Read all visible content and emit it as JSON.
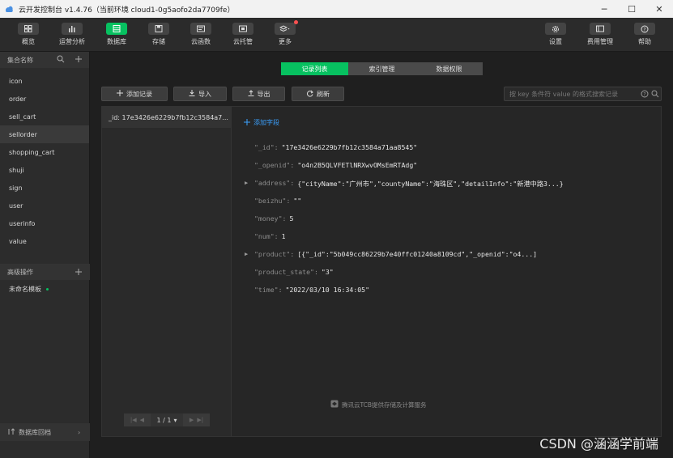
{
  "window": {
    "title": "云开发控制台 v1.4.76（当前环境 cloud1-0g5aofo2da7709fe）",
    "controls": [
      "minimize-icon",
      "maximize-icon",
      "close-icon"
    ]
  },
  "toolbar": {
    "items": [
      {
        "label": "概览",
        "icon": "overview-icon"
      },
      {
        "label": "运营分析",
        "icon": "analytics-icon"
      },
      {
        "label": "数据库",
        "icon": "database-icon",
        "active": true
      },
      {
        "label": "存储",
        "icon": "storage-icon"
      },
      {
        "label": "云函数",
        "icon": "function-icon"
      },
      {
        "label": "云托管",
        "icon": "cloud-hosting-icon"
      },
      {
        "label": "更多",
        "icon": "more-icon",
        "badge": true
      }
    ],
    "right_items": [
      {
        "label": "设置",
        "icon": "settings-icon"
      },
      {
        "label": "费用管理",
        "icon": "billing-icon"
      },
      {
        "label": "帮助",
        "icon": "help-icon"
      }
    ],
    "accent": "#07c160"
  },
  "sidebar": {
    "header": "集合名称",
    "collections": [
      "icon",
      "order",
      "sell_cart",
      "sellorder",
      "shopping_cart",
      "shuji",
      "sign",
      "user",
      "userinfo",
      "value"
    ],
    "selected": "sellorder",
    "advanced_header": "高级操作",
    "advanced_item": "未命名模板",
    "footer": "数据库回档"
  },
  "tabs": [
    "记录列表",
    "索引管理",
    "数据权限"
  ],
  "actions": {
    "add": "添加记录",
    "import": "导入",
    "export": "导出",
    "refresh": "刷新"
  },
  "search": {
    "placeholder": "按 key 条件符 value 的格式搜索记录"
  },
  "records": {
    "items": [
      "_id: 17e3426e6229b7fb12c3584a7..."
    ],
    "pager": "1 / 1"
  },
  "detail": {
    "add_field": "添加字段",
    "fields": [
      {
        "key": "\"_id\"",
        "value": "\"17e3426e6229b7fb12c3584a71aa8545\"",
        "expandable": false
      },
      {
        "key": "\"_openid\"",
        "value": "\"o4n2B5QLVFETlNRXwvOMsEmRTAdg\"",
        "expandable": false
      },
      {
        "key": "\"address\"",
        "value": "{\"cityName\":\"广州市\",\"countyName\":\"海珠区\",\"detailInfo\":\"新港中路3...}",
        "expandable": true
      },
      {
        "key": "\"beizhu\"",
        "value": "\"\"",
        "expandable": false
      },
      {
        "key": "\"money\"",
        "value": "5",
        "expandable": false
      },
      {
        "key": "\"num\"",
        "value": "1",
        "expandable": false
      },
      {
        "key": "\"product\"",
        "value": "[{\"_id\":\"5b049cc86229b7e40ffc01240a8109cd\",\"_openid\":\"o4...]",
        "expandable": true
      },
      {
        "key": "\"product_state\"",
        "value": "\"3\"",
        "expandable": false
      },
      {
        "key": "\"time\"",
        "value": "\"2022/03/10 16:34:05\"",
        "expandable": false
      }
    ]
  },
  "footer_note": "腾讯云TCB提供存储及计算服务",
  "watermark": "CSDN @涵涵学前端"
}
